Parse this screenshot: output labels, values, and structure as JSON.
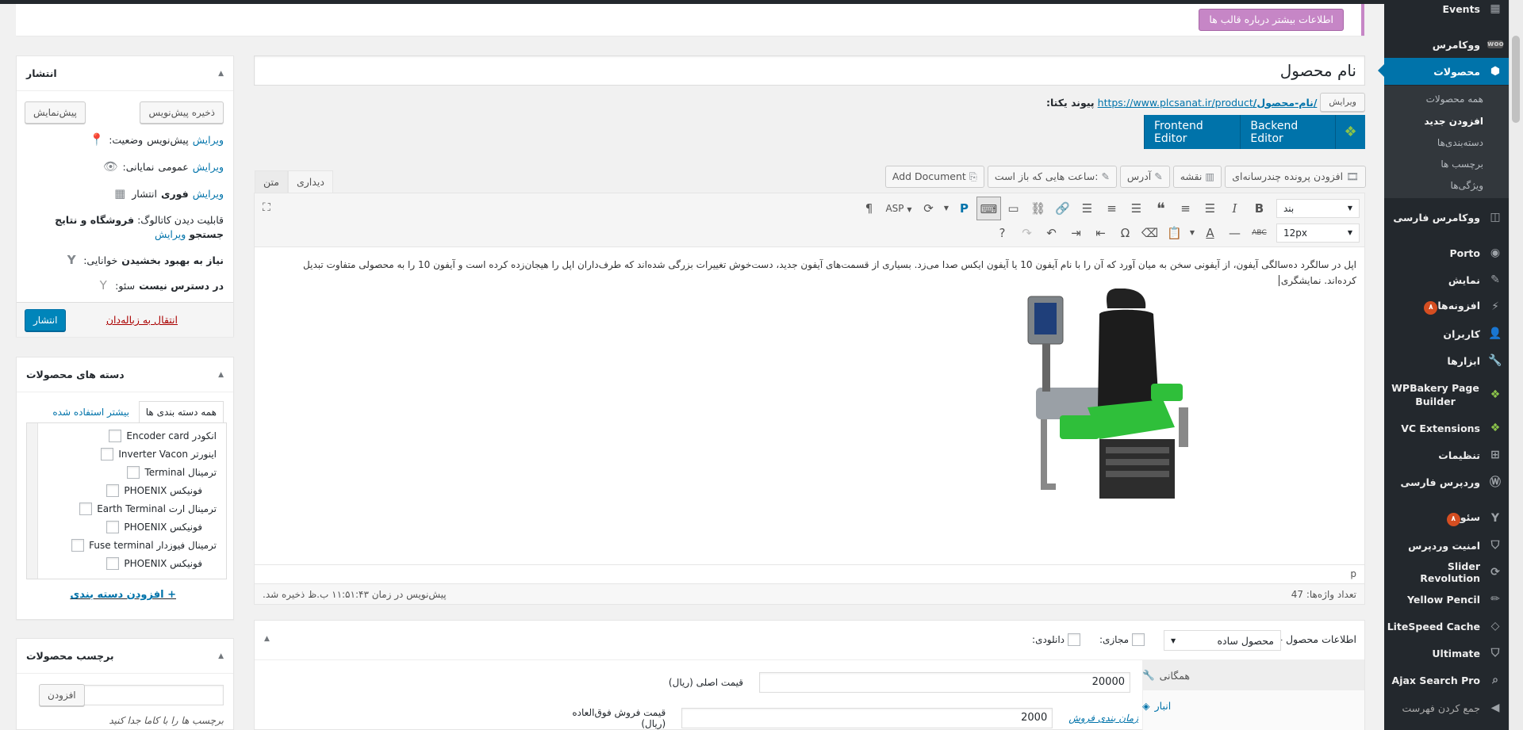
{
  "notice": {
    "button": "اطلاعات بیشتر درباره قالب ها"
  },
  "sidebar": {
    "items": [
      {
        "label": "Events",
        "icon": "calendar-icon"
      },
      {
        "label": "ووکامرس",
        "icon": "woo-icon"
      },
      {
        "label": "محصولات",
        "icon": "box-icon"
      },
      {
        "label": "ووکامرس فارسی",
        "icon": "woo-icon"
      },
      {
        "label": "Porto",
        "icon": "circle-icon"
      },
      {
        "label": "نمایش",
        "icon": "brush-icon"
      },
      {
        "label": "افزونه‌ها",
        "icon": "plug-icon",
        "badge": "۸"
      },
      {
        "label": "کاربران",
        "icon": "user-icon"
      },
      {
        "label": "ابزارها",
        "icon": "wrench-icon"
      },
      {
        "label": "WPBakery Page Builder",
        "icon": "wpbakery-icon"
      },
      {
        "label": "VC Extensions",
        "icon": "wpbakery-icon"
      },
      {
        "label": "تنظیمات",
        "icon": "settings-icon"
      },
      {
        "label": "وردپرس فارسی",
        "icon": "wordpress-icon"
      },
      {
        "label": "سئو",
        "icon": "yoast-icon",
        "badge": "۸"
      },
      {
        "label": "امنیت وردپرس",
        "icon": "shield-icon"
      },
      {
        "label": "Slider Revolution",
        "icon": "refresh-icon"
      },
      {
        "label": "Yellow Pencil",
        "icon": "pencil-icon"
      },
      {
        "label": "LiteSpeed Cache",
        "icon": "diamond-icon"
      },
      {
        "label": "Ultimate",
        "icon": "shield-icon"
      },
      {
        "label": "Ajax Search Pro",
        "icon": "search-icon"
      },
      {
        "label": "جمع کردن فهرست",
        "icon": "collapse-icon"
      }
    ],
    "submenu": [
      "همه محصولات",
      "افزودن جدید",
      "دسته‌بندی‌ها",
      "برچسب ها",
      "ویژگی‌ها"
    ]
  },
  "publish": {
    "title": "انتشار",
    "save_draft": "ذخیره پیش‌نویس",
    "preview": "پیش‌نمایش",
    "status_label": "وضعیت:",
    "status_value": "پیش‌نویس",
    "visibility_label": "نمایانی:",
    "visibility_value": "عمومی",
    "publish_label": "انتشار",
    "publish_value": "فوری",
    "edit": "ویرایش",
    "catalog_label": "قابلیت دیدن کاتالوگ:",
    "catalog_value1": "فروشگاه و نتایج",
    "catalog_value2": "جستجو",
    "readability_label": "خوانایی:",
    "readability_value": "نیاز به بهبود بخشیدن",
    "seo_label": "سئو:",
    "seo_value": "در دسترس نیست",
    "trash": "انتقال به زباله‌دان",
    "publish_button": "انتشار"
  },
  "categories": {
    "title": "دسته های محصولات",
    "tab_all": "همه دسته بندی ها",
    "tab_used": "بیشتر استفاده شده",
    "items": [
      {
        "label": "انکودر Encoder card",
        "level": 0
      },
      {
        "label": "اینورتر Inverter Vacon",
        "level": 0
      },
      {
        "label": "ترمینال Terminal",
        "level": 0
      },
      {
        "label": "فونیکس PHOENIX",
        "level": 1
      },
      {
        "label": "ترمینال ارت Earth Terminal",
        "level": 0
      },
      {
        "label": "فونیکس PHOENIX",
        "level": 1
      },
      {
        "label": "ترمینال فیوزدار Fuse terminal",
        "level": 0
      },
      {
        "label": "فونیکس PHOENIX",
        "level": 1
      }
    ],
    "add_link": "+ افزودن دسته بندی"
  },
  "tags": {
    "title": "برچسب محصولات",
    "add_button": "افزودن",
    "hint": "برچسب ها را با کاما جدا کنید"
  },
  "post": {
    "title": "نام محصول",
    "permalink_label": "پیوند یکتا:",
    "permalink_base": "https://www.plcsanat.ir/product",
    "permalink_slug": "/نام-محصول/",
    "permalink_edit": "ویرایش"
  },
  "vc": {
    "backend": "Backend Editor",
    "frontend": "Frontend Editor"
  },
  "media_buttons": [
    {
      "label": "افزودن پرونده چندرسانه‌ای",
      "icon": "media-icon"
    },
    {
      "label": "نقشه",
      "icon": "map-icon"
    },
    {
      "label": "آدرس",
      "icon": "location-icon"
    },
    {
      "label": "ساعت هایی که باز است:",
      "icon": "clock-icon"
    },
    {
      "label": "Add Document",
      "icon": "document-icon"
    }
  ],
  "editor": {
    "tab_visual": "دیداری",
    "tab_text": "متن",
    "format_select": "بند",
    "size_select": "12px",
    "asp_label": "ASP",
    "p_label": "P",
    "content": "اپل در سالگرد ده‌سالگی آیفون، از آیفونی سخن به میان آورد که آن را با نام آیفون 10 یا آیفون ایکس صدا می‌زد. بسیاری از قسمت‌های آیفون جدید، دست‌خوش تغییرات بزرگی شده‌اند که طرف‌داران اپل را هیجان‌زده کرده است و آیفون 10 را به محصولی متفاوت تبدیل کرده‌اند. نمایشگری",
    "path": "p",
    "word_count": "تعداد واژه‌ها: 47",
    "draft_saved": "پیش‌نویس در زمان ۱۱:۵۱:۴۳ ب.ظ ذخیره شد."
  },
  "product_data": {
    "label": "اطلاعات محصول —",
    "type_select": "محصول ساده",
    "virtual": "مجازی:",
    "downloadable": "دانلودی:",
    "tabs": [
      {
        "label": "همگانی",
        "icon": "wrench-icon"
      },
      {
        "label": "انبار",
        "icon": "inventory-icon"
      }
    ],
    "regular_price_label": "قیمت اصلی (ریال)",
    "regular_price": "20000",
    "sale_price_label": "قیمت فروش فوق‌العاده (ریال)",
    "sale_price": "2000",
    "schedule_link": "زمان بندی فروش"
  }
}
